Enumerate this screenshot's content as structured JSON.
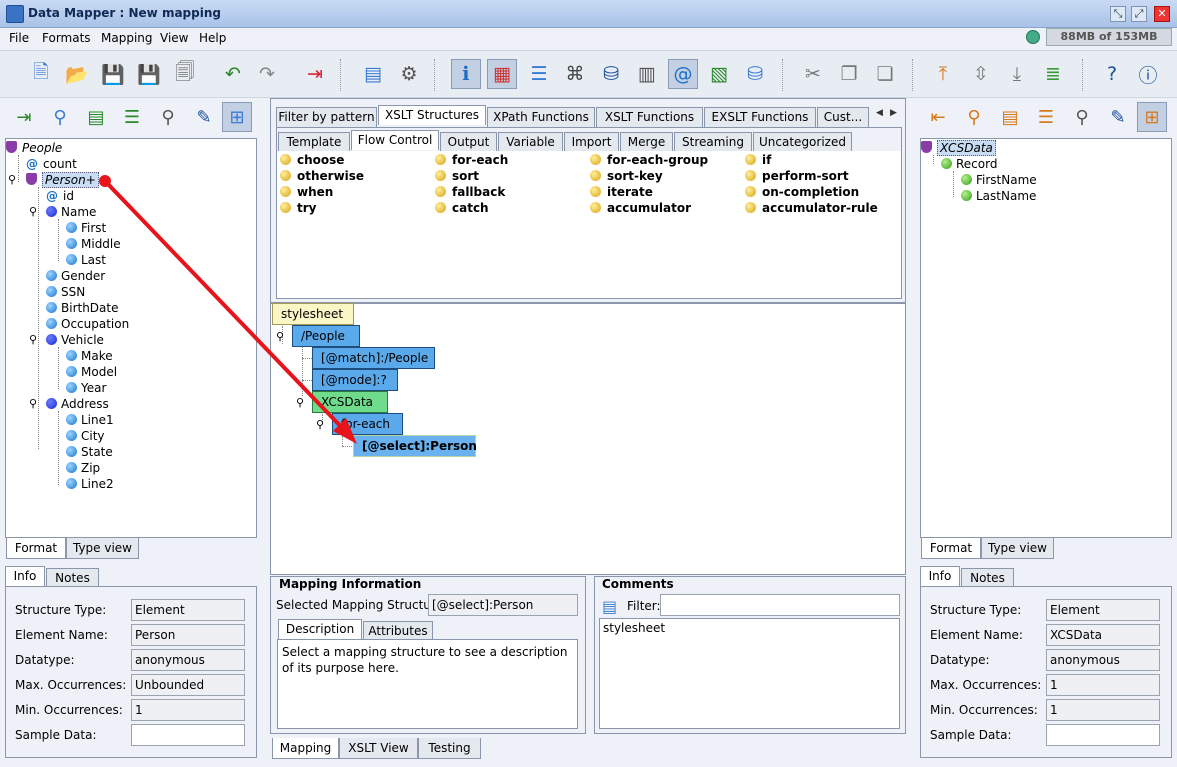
{
  "window": {
    "title": "Data Mapper : New mapping"
  },
  "menu": [
    {
      "label": "File"
    },
    {
      "label": "Formats"
    },
    {
      "label": "Mapping"
    },
    {
      "label": "View"
    },
    {
      "label": "Help"
    }
  ],
  "memory": {
    "label": "88MB of 153MB"
  },
  "toolbar": {
    "icons": [
      "new-mapping-icon",
      "open-icon",
      "save-icon",
      "save-as-icon",
      "xls-export-icon",
      "undo-icon",
      "redo-icon",
      "exit-icon",
      "new-format-icon",
      "format-settings-icon",
      "info-icon",
      "color-icon",
      "document-list-icon",
      "xslt-view-icon",
      "save-db-icon",
      "grid-icon",
      "at-format-icon",
      "data-icon",
      "database-icon",
      "cut-icon",
      "copy-icon",
      "paste-icon",
      "move-up-icon",
      "move-node-icon",
      "move-down-icon",
      "layers-icon",
      "help-icon",
      "about-icon"
    ]
  },
  "left": {
    "tree": {
      "root": "People",
      "count": "count",
      "person": "Person+",
      "id": "id",
      "name": "Name",
      "first": "First",
      "middle": "Middle",
      "last": "Last",
      "gender": "Gender",
      "ssn": "SSN",
      "birthdate": "BirthDate",
      "occupation": "Occupation",
      "vehicle": "Vehicle",
      "make": "Make",
      "model": "Model",
      "year": "Year",
      "address": "Address",
      "line1": "Line1",
      "city": "City",
      "state": "State",
      "zip": "Zip",
      "line2": "Line2"
    },
    "view_tabs": {
      "format": "Format",
      "type": "Type view"
    },
    "info_tabs": {
      "info": "Info",
      "notes": "Notes"
    },
    "info": {
      "structure_type_label": "Structure Type:",
      "structure_type": "Element",
      "element_name_label": "Element Name:",
      "element_name": "Person",
      "datatype_label": "Datatype:",
      "datatype": "anonymous",
      "max_occ_label": "Max. Occurrences:",
      "max_occ": "Unbounded",
      "min_occ_label": "Min. Occurrences:",
      "min_occ": "1",
      "sample_label": "Sample Data:",
      "sample": ""
    }
  },
  "center": {
    "top_tabs": [
      "Filter by pattern",
      "XSLT Structures",
      "XPath Functions",
      "XSLT Functions",
      "EXSLT Functions",
      "Cust..."
    ],
    "sub_tabs": [
      "Template",
      "Flow Control",
      "Output",
      "Variable",
      "Import",
      "Merge",
      "Streaming",
      "Uncategorized"
    ],
    "functions": {
      "c1": [
        "choose",
        "otherwise",
        "when",
        "try"
      ],
      "c2": [
        "for-each",
        "sort",
        "fallback",
        "catch"
      ],
      "c3": [
        "for-each-group",
        "sort-key",
        "iterate",
        "accumulator"
      ],
      "c4": [
        "if",
        "perform-sort",
        "on-completion",
        "accumulator-rule"
      ]
    },
    "mapping_tree": {
      "stylesheet": "stylesheet",
      "people": "/People",
      "match": "[@match]:/People",
      "mode": "[@mode]:?",
      "xcsdata": "XCSData",
      "foreach": "for-each",
      "select": "[@select]:Person"
    },
    "mapping_info": {
      "title": "Mapping Information",
      "selected_label": "Selected Mapping Structure:",
      "selected_value": "[@select]:Person",
      "tabs": {
        "description": "Description",
        "attributes": "Attributes"
      },
      "description": "Select a mapping structure to see a description of its purpose here."
    },
    "comments": {
      "title": "Comments",
      "filter_label": "Filter:",
      "filter_value": "",
      "item": "stylesheet"
    },
    "bottom_tabs": {
      "mapping": "Mapping",
      "xslt": "XSLT View",
      "testing": "Testing"
    }
  },
  "right": {
    "tree": {
      "root": "XCSData",
      "record": "Record",
      "first": "FirstName",
      "last": "LastName"
    },
    "view_tabs": {
      "format": "Format",
      "type": "Type view"
    },
    "info_tabs": {
      "info": "Info",
      "notes": "Notes"
    },
    "info": {
      "structure_type_label": "Structure Type:",
      "structure_type": "Element",
      "element_name_label": "Element Name:",
      "element_name": "XCSData",
      "datatype_label": "Datatype:",
      "datatype": "anonymous",
      "max_occ_label": "Max. Occurrences:",
      "max_occ": "1",
      "min_occ_label": "Min. Occurrences:",
      "min_occ": "1",
      "sample_label": "Sample Data:",
      "sample": ""
    }
  },
  "colors": {
    "drag_arrow": "#e8141b",
    "selected_node": "#c8dcf4"
  }
}
